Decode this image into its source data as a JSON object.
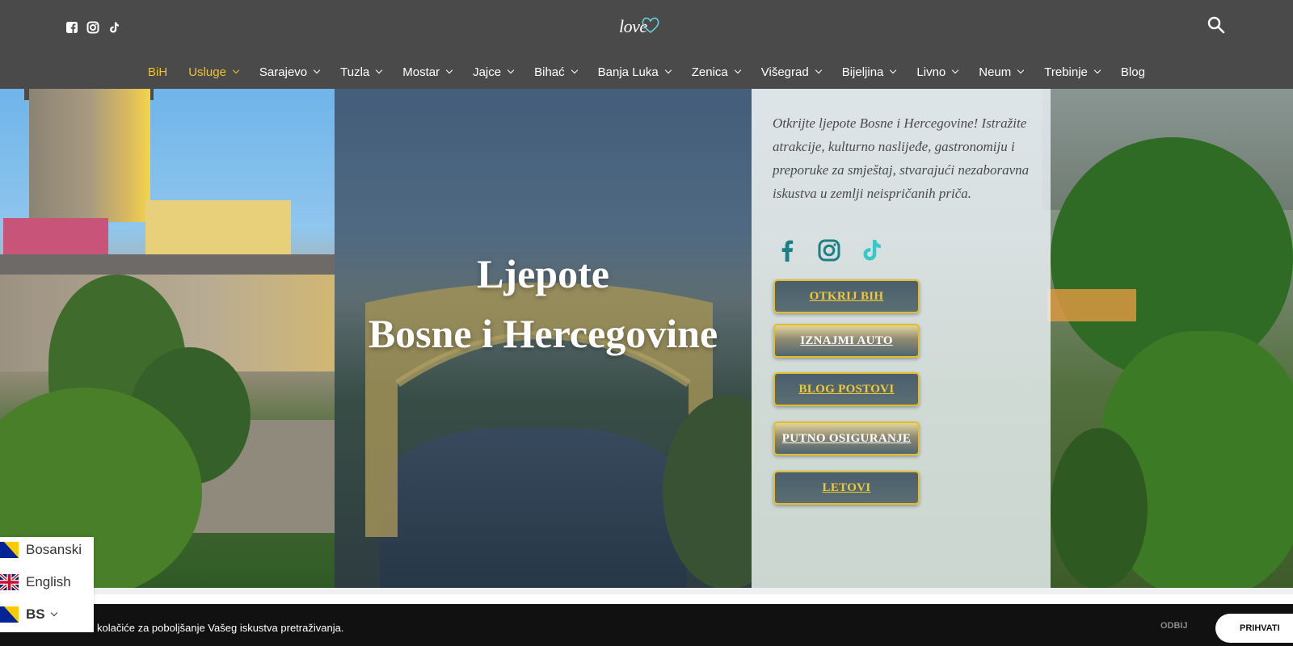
{
  "brand": {
    "logo_text": "love"
  },
  "header": {
    "social": [
      {
        "icon": "facebook-icon"
      },
      {
        "icon": "instagram-icon"
      },
      {
        "icon": "tiktok-icon"
      }
    ],
    "search_icon": "search-icon"
  },
  "nav": {
    "items": [
      {
        "label": "BiH",
        "dropdown": false,
        "active": true
      },
      {
        "label": "Usluge",
        "dropdown": true,
        "active": true
      },
      {
        "label": "Sarajevo",
        "dropdown": true
      },
      {
        "label": "Tuzla",
        "dropdown": true
      },
      {
        "label": "Mostar",
        "dropdown": true
      },
      {
        "label": "Jajce",
        "dropdown": true
      },
      {
        "label": "Bihać",
        "dropdown": true
      },
      {
        "label": "Banja Luka",
        "dropdown": true
      },
      {
        "label": "Zenica",
        "dropdown": true
      },
      {
        "label": "Višegrad",
        "dropdown": true
      },
      {
        "label": "Bijeljina",
        "dropdown": true
      },
      {
        "label": "Livno",
        "dropdown": true
      },
      {
        "label": "Neum",
        "dropdown": true
      },
      {
        "label": "Trebinje",
        "dropdown": true
      },
      {
        "label": "Blog",
        "dropdown": false
      }
    ]
  },
  "hero": {
    "title_line1": "Ljepote",
    "title_line2": "Bosne i Hercegovine",
    "intro": "Otkrijte ljepote Bosne i Hercegovine! Istražite atrakcije, kulturno naslijeđe, gastronomiju i preporuke za smještaj, stvarajući nezaboravna iskustva u zemlji neispričanih priča.",
    "social": [
      {
        "icon": "facebook-icon"
      },
      {
        "icon": "instagram-icon"
      },
      {
        "icon": "tiktok-icon"
      }
    ],
    "buttons": {
      "discover": "OTKRIJ BIH",
      "rent_car": "IZNAJMI AUTO",
      "blog_posts": "BLOG POSTOVI",
      "travel_insurance": "PUTNO OSIGURANJE",
      "flights": "LETOVI"
    }
  },
  "cookie": {
    "text": "kolačiće za poboljšanje Vašeg iskustva pretraživanja.",
    "decline": "ODBIJ",
    "accept": "PRIHVATI"
  },
  "language": {
    "options": [
      {
        "label": "Bosanski",
        "flag": "bosnia-flag-icon"
      },
      {
        "label": "English",
        "flag": "uk-flag-icon"
      }
    ],
    "current": {
      "label": "BS",
      "flag": "bosnia-flag-icon"
    }
  },
  "colors": {
    "header_bg": "#4a4a4a",
    "accent_gold": "#f0c330",
    "button_teal": "#4a5f6c",
    "cookie_bg": "#111111",
    "instagram_teal": "#1d7f86",
    "tiktok_cyan": "#35c8c9"
  }
}
